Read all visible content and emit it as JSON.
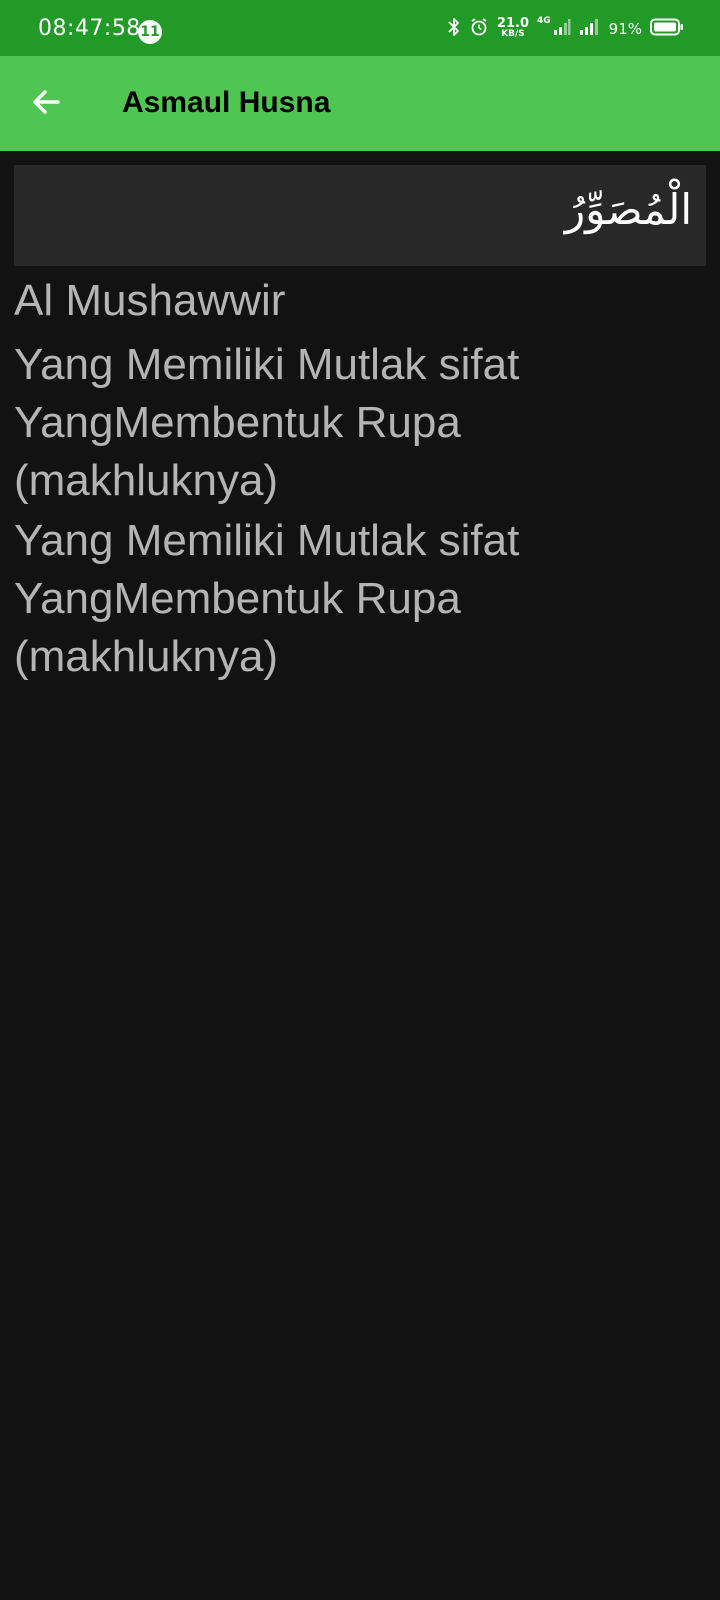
{
  "status_bar": {
    "time": "08:47:58",
    "notification_count": "11",
    "net_speed_value": "21.0",
    "net_speed_unit": "KB/S",
    "network_type": "4G",
    "battery_percent": "91%"
  },
  "app_bar": {
    "title": "Asmaul Husna",
    "back_icon": "arrow-left-icon"
  },
  "detail": {
    "arabic_name": "الْمُصَوِّرُ",
    "latin_name": "Al Mushawwir",
    "meaning_1": "Yang Memiliki Mutlak sifat YangMembentuk Rupa (makhluknya)",
    "meaning_2": "Yang Memiliki Mutlak sifat YangMembentuk Rupa (makhluknya)"
  },
  "colors": {
    "status_bar": "#229a27",
    "app_bar": "#4fc552",
    "background": "#121212",
    "arabic_box": "#282828",
    "text": "#b4b4b4"
  }
}
